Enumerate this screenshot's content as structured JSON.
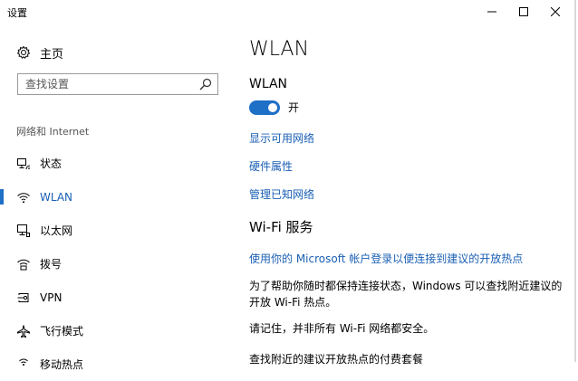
{
  "window": {
    "title": "设置"
  },
  "sidebar": {
    "home_label": "主页",
    "search_placeholder": "查找设置",
    "section_label": "网络和 Internet",
    "items": [
      {
        "label": "状态",
        "icon": "status-icon"
      },
      {
        "label": "WLAN",
        "icon": "wifi-icon",
        "active": true
      },
      {
        "label": "以太网",
        "icon": "ethernet-icon"
      },
      {
        "label": "拨号",
        "icon": "dialup-icon"
      },
      {
        "label": "VPN",
        "icon": "vpn-icon"
      },
      {
        "label": "飞行模式",
        "icon": "airplane-icon"
      },
      {
        "label": "移动热点",
        "icon": "hotspot-icon"
      }
    ]
  },
  "main": {
    "title": "WLAN",
    "wlan_label": "WLAN",
    "toggle_state": "开",
    "toggle_on": true,
    "links": [
      "显示可用网络",
      "硬件属性",
      "管理已知网络"
    ],
    "wifi_service_title": "Wi-Fi 服务",
    "service_link": "使用你的 Microsoft 帐户登录以便连接到建议的开放热点",
    "para1_line1": "为了帮助你随时都保持连接状态，Windows 可以查找附近建议的",
    "para1_line2": "开放 Wi-Fi 热点。",
    "para2": "请记住，并非所有 Wi-Fi 网络都安全。",
    "para3": "查找附近的建议开放热点的付费套餐"
  },
  "colors": {
    "accent": "#1e6fc6",
    "link": "#1a5fb4"
  }
}
